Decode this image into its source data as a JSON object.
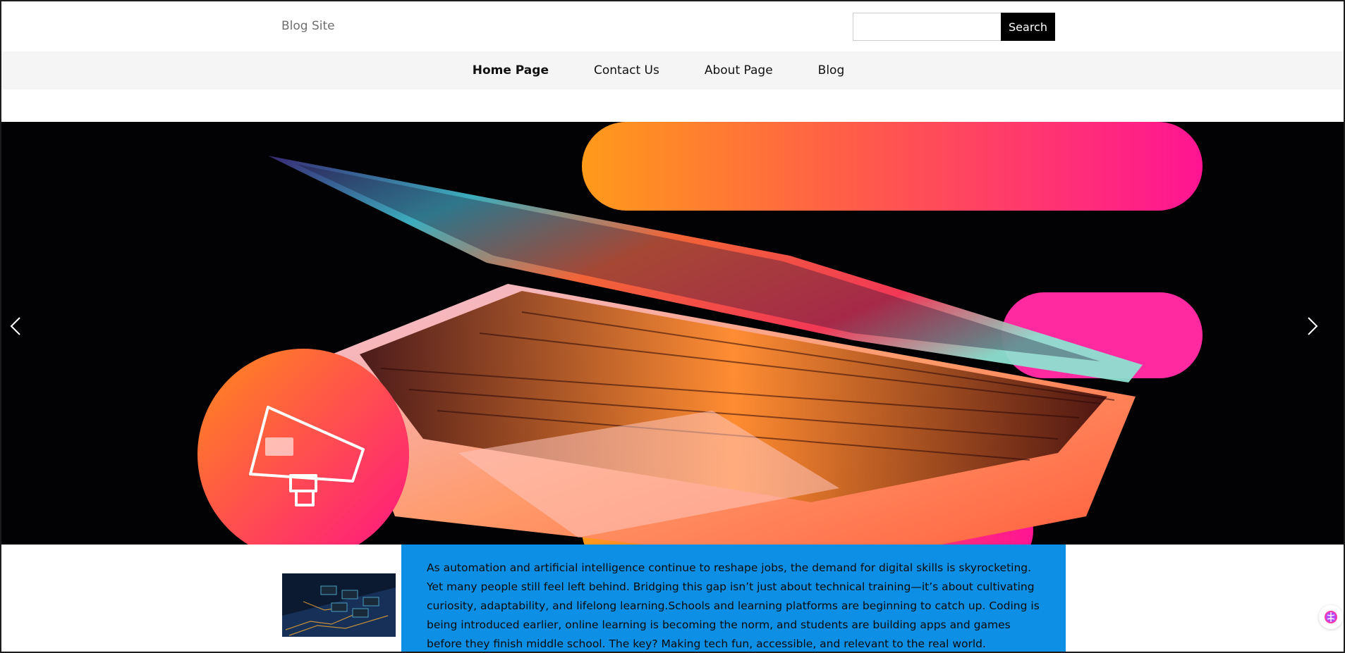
{
  "header": {
    "site_name": "Blog Site",
    "search": {
      "placeholder": "",
      "value": "",
      "button_label": "Search"
    }
  },
  "nav": {
    "items": [
      {
        "label": "Home Page",
        "active": true
      },
      {
        "label": "Contact Us",
        "active": false
      },
      {
        "label": "About Page",
        "active": false
      },
      {
        "label": "Blog",
        "active": false
      }
    ]
  },
  "hero": {
    "icons": {
      "prev": "chevron-left-icon",
      "next": "chevron-right-icon",
      "promo": "megaphone-icon"
    },
    "colors": {
      "gradient_start": "#ff9a1a",
      "gradient_end": "#ff1493"
    }
  },
  "article": {
    "excerpt": "As automation and artificial intelligence continue to reshape jobs, the demand for digital skills is skyrocketing. Yet many people still feel left behind. Bridging this gap isn’t just about technical training—it’s about cultivating curiosity, adaptability, and lifelong learning.Schools and learning platforms are beginning to catch up. Coding is being introduced earlier, online learning is becoming the norm, and students are building apps and games before they finish middle school. The key? Making tech fun, accessible, and relevant to the real world.",
    "box_color": "#0d8fe6"
  }
}
